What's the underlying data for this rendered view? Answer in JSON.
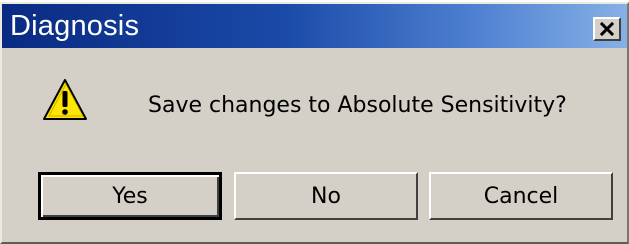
{
  "window": {
    "title": "Diagnosis",
    "close_icon": "close-icon"
  },
  "body": {
    "icon": "warning-icon",
    "message": "Save changes to Absolute Sensitivity?"
  },
  "buttons": {
    "yes_label": "Yes",
    "no_label": "No",
    "cancel_label": "Cancel",
    "default": "yes"
  },
  "colors": {
    "titlebar_start": "#0a2a82",
    "titlebar_end": "#86b0e6",
    "dialog_face": "#d4d0c8",
    "warning_fill": "#ffe600"
  }
}
